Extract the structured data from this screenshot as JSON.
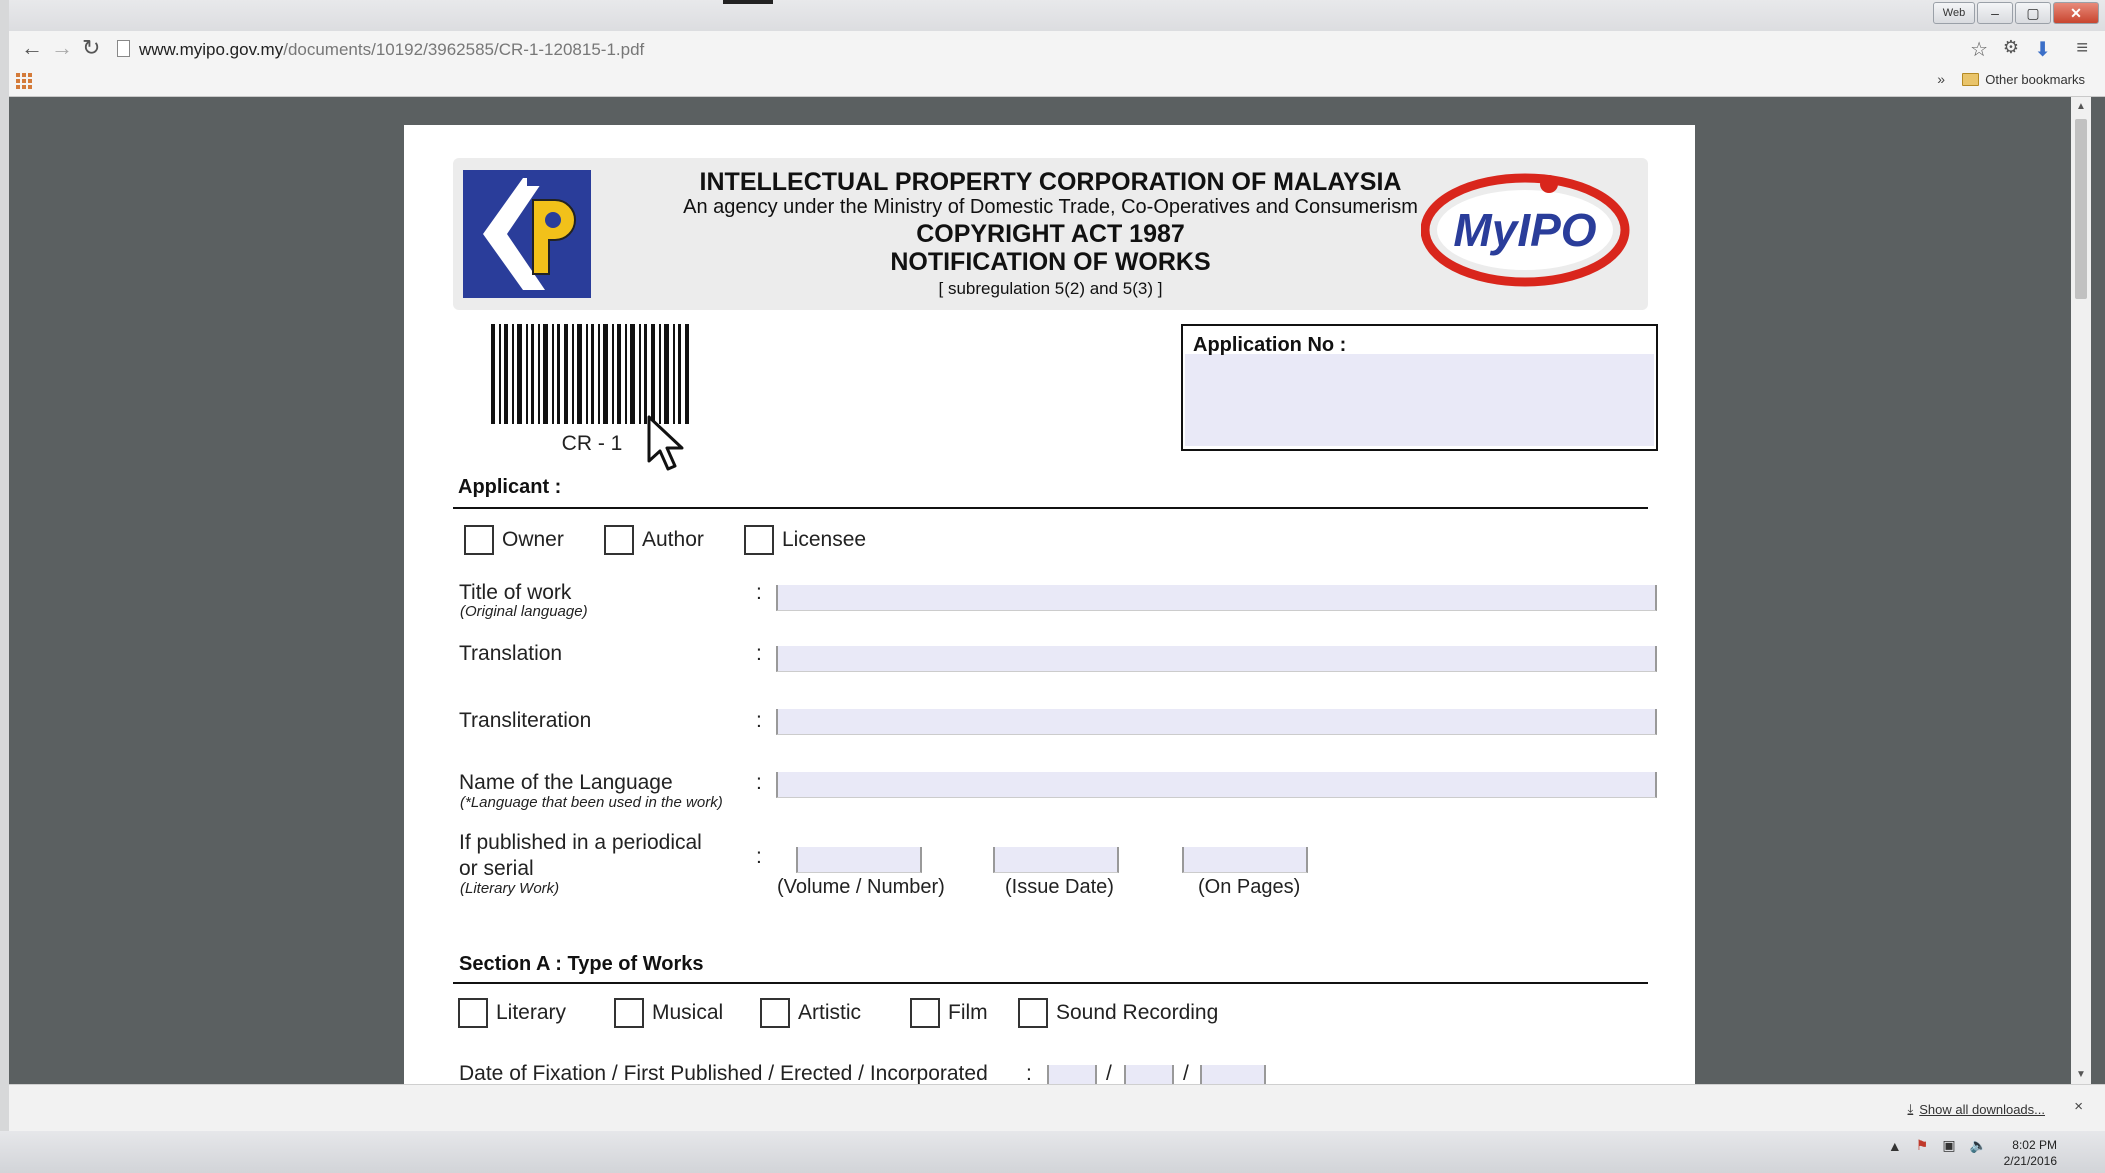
{
  "browser": {
    "url_host": "www.myipo.gov.my",
    "url_path": "/documents/10192/3962585/CR-1-120815-1.pdf",
    "window_buttons": {
      "user": "Web",
      "minimize": "–",
      "maximize": "▢",
      "close": "✕"
    },
    "bookmarks": {
      "overflow": "»",
      "other_bookmarks": "Other bookmarks"
    }
  },
  "icons": {
    "back": "back-arrow-icon",
    "forward": "forward-arrow-icon",
    "reload": "reload-icon",
    "star": "star-icon",
    "menu": "hamburger-menu-icon",
    "download": "download-icon"
  },
  "form_header": {
    "org": "INTELLECTUAL PROPERTY CORPORATION OF  MALAYSIA",
    "agency": "An agency under the Ministry of Domestic Trade, Co-Operatives and Consumerism",
    "act": "COPYRIGHT ACT 1987",
    "doc_title": "NOTIFICATION OF WORKS",
    "regulation": "[ subregulation 5(2) and 5(3) ]",
    "logo_right_text": "MyIPO"
  },
  "barcode": {
    "label": "CR - 1"
  },
  "application_no": {
    "label": "Application No :"
  },
  "applicant": {
    "title": "Applicant :",
    "options": [
      "Owner",
      "Author",
      "Licensee"
    ]
  },
  "fields": {
    "colon": ":",
    "title_of_work": {
      "label": "Title of work",
      "sub": "(Original language)"
    },
    "translation": {
      "label": "Translation"
    },
    "transliteration": {
      "label": "Transliteration"
    },
    "language": {
      "label": "Name of the Language",
      "sub": "(*Language that been used in the work)"
    },
    "periodical": {
      "label_line1": "If published in a periodical",
      "label_line2": "or serial",
      "sub": "(Literary Work)",
      "cap_volume": "(Volume / Number)",
      "cap_issue": "(Issue Date)",
      "cap_pages": "(On Pages)"
    }
  },
  "section_a": {
    "title": "Section A : Type of Works",
    "options": [
      "Literary",
      "Musical",
      "Artistic",
      "Film",
      "Sound Recording"
    ],
    "date_label": "Date of Fixation / First Published / Erected / Incorporated",
    "date_sep": "/"
  },
  "downloads": {
    "show_all": "Show all downloads...",
    "close": "×"
  },
  "taskbar": {
    "time": "8:02 PM",
    "date": "2/21/2016"
  }
}
